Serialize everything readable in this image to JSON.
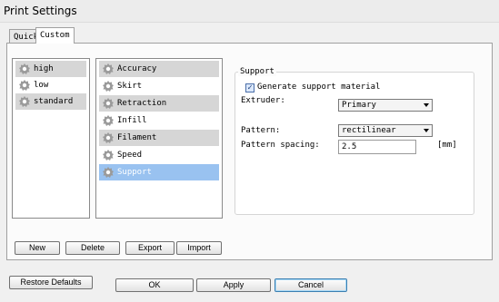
{
  "window": {
    "title": "Print Settings"
  },
  "tabs": [
    {
      "label": "Quick"
    },
    {
      "label": "Custom"
    }
  ],
  "profiles": [
    {
      "label": "high"
    },
    {
      "label": "low"
    },
    {
      "label": "standard"
    }
  ],
  "categories": [
    {
      "label": "Accuracy"
    },
    {
      "label": "Skirt"
    },
    {
      "label": "Retraction"
    },
    {
      "label": "Infill"
    },
    {
      "label": "Filament"
    },
    {
      "label": "Speed"
    },
    {
      "label": "Support"
    }
  ],
  "profile_buttons": {
    "new": "New",
    "delete": "Delete",
    "export": "Export",
    "import": "Import"
  },
  "support": {
    "group_label": "Support",
    "generate_label": "Generate support material",
    "generate_checked": true,
    "extruder_label": "Extruder:",
    "extruder_value": "Primary",
    "pattern_label": "Pattern:",
    "pattern_value": "rectilinear",
    "spacing_label": "Pattern spacing:",
    "spacing_value": "2.5",
    "spacing_unit": "[mm]"
  },
  "footer": {
    "restore": "Restore Defaults",
    "ok": "OK",
    "apply": "Apply",
    "cancel": "Cancel"
  },
  "icons": {
    "profile": "gear-icon",
    "category": "gear-icon"
  },
  "colors": {
    "selection": "#99c2f0",
    "alt_row": "#d6d6d6"
  }
}
